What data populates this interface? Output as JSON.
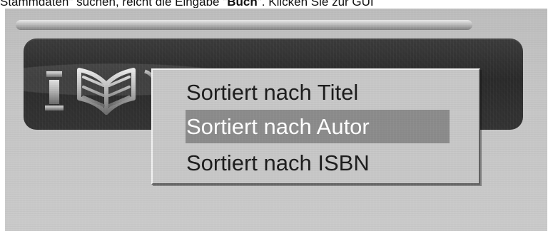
{
  "caption": {
    "prefix_fragment": "Stammdaten",
    "middle": "\" suchen, reicht die Eingabe \"",
    "bold_term": "Buch",
    "suffix": "\". Klicken Sie zur GUI"
  },
  "menu": {
    "items": [
      {
        "label": "Sortiert nach Titel",
        "selected": false
      },
      {
        "label": "Sortiert nach Autor",
        "selected": true
      },
      {
        "label": "Sortiert nach ISBN",
        "selected": false
      }
    ]
  },
  "icons": {
    "logo": "book-logo-icon"
  }
}
